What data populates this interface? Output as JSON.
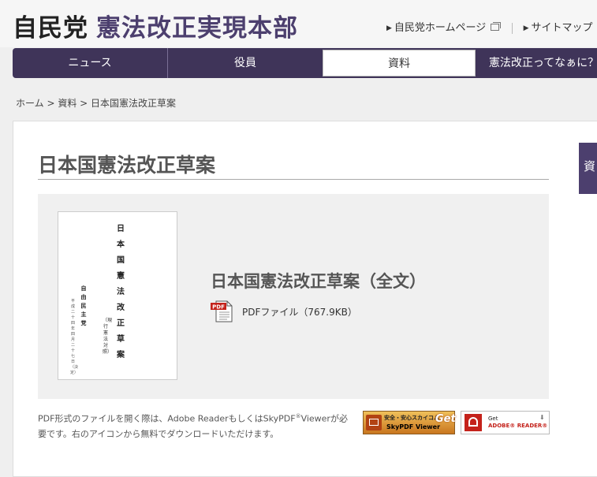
{
  "header": {
    "logo_party": "自民党",
    "logo_title": "憲法改正実現本部",
    "links": [
      {
        "label": "自民党ホームページ"
      },
      {
        "label": "サイトマップ"
      }
    ]
  },
  "nav": {
    "items": [
      {
        "label": "ニュース"
      },
      {
        "label": "役員"
      },
      {
        "label": "資料",
        "active": true
      },
      {
        "label": "憲法改正ってなぁに？"
      }
    ]
  },
  "breadcrumb": "ホーム > 資料 > 日本国憲法改正草案",
  "page": {
    "title": "日本国憲法改正草案",
    "document": {
      "heading": "日本国憲法改正草案（全文）",
      "pdf_link": "PDFファイル（767.9KB）",
      "thumbnail": {
        "title": "日本国憲法改正草案",
        "subtitle": "（現行憲法対照）",
        "party": "自由民主党",
        "date": "平成二十四年四月二十七日（決定）"
      }
    },
    "notice": {
      "part1": "PDF形式のファイルを開く際は、Adobe ReaderもしくはSkyPDF",
      "reg": "®",
      "part2": "Viewerが必要です。右のアイコンから無料でダウンロードいただけます。"
    },
    "badges": {
      "skypdf": {
        "top": "安全・安心スカイコム",
        "bottom": "SkyPDF Viewer",
        "get": "Get"
      },
      "adobe": {
        "get": "Get",
        "name": "ADOBE® READER®"
      }
    }
  },
  "side_tab_label": "資",
  "colors": {
    "brand": "#4c3f6e",
    "nav_bg": "#3f3459",
    "pdf_red": "#c4221b"
  }
}
